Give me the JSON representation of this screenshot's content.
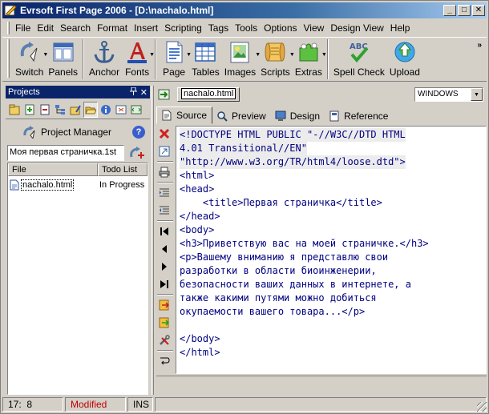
{
  "window": {
    "title": "Evrsoft First Page 2006 - [D:\\nachalo.html]",
    "buttons": {
      "minimize": "_",
      "maximize": "□",
      "close": "✕"
    }
  },
  "menu": [
    "File",
    "Edit",
    "Search",
    "Format",
    "Insert",
    "Scripting",
    "Tags",
    "Tools",
    "Options",
    "View",
    "Design View",
    "Help"
  ],
  "toolbar": {
    "switch": "Switch",
    "panels": "Panels",
    "anchor": "Anchor",
    "fonts": "Fonts",
    "page": "Page",
    "tables": "Tables",
    "images": "Images",
    "scripts": "Scripts",
    "extras": "Extras",
    "spell_check": "Spell Check",
    "upload": "Upload",
    "more": "»"
  },
  "projects": {
    "title": "Projects",
    "manager_label": "Project Manager",
    "help": "?",
    "selected_project": "Моя первая страничка.1st",
    "columns": {
      "file": "File",
      "todo": "Todo List"
    },
    "files": [
      {
        "name": "nachalo.html",
        "status": "In Progress"
      }
    ]
  },
  "document": {
    "tab_name": "nachalo.html",
    "line_endings": "WINDOWS"
  },
  "views": {
    "source": "Source",
    "preview": "Preview",
    "design": "Design",
    "reference": "Reference"
  },
  "code": [
    "<!DOCTYPE HTML PUBLIC \"-//W3C//DTD HTML",
    "4.01 Transitional//EN\"",
    "\"http://www.w3.org/TR/html4/loose.dtd\">",
    "<html>",
    "<head>",
    "    <title>Первая страничка</title>",
    "</head>",
    "<body>",
    "<h3>Приветствую вас на моей страничке.</h3>",
    "<p>Вашему вниманию я представлю свои",
    "разработки в области биоинженерии,",
    "безопасности ваших данных в интернете, а",
    "также какими путями можно добиться",
    "окупаемости вашего товара...</p>",
    "",
    "</body>",
    "</html>"
  ],
  "status": {
    "position": "17:  8",
    "modified": "Modified",
    "mode": "INS"
  },
  "colors": {
    "title_bar": "#0a246a",
    "code_text": "#000080",
    "modified_text": "#c00000"
  }
}
